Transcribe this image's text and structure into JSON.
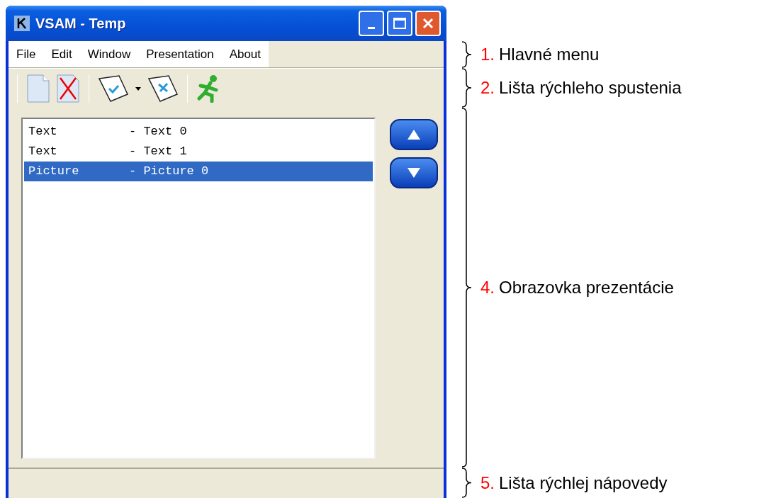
{
  "window": {
    "title": "VSAM - Temp"
  },
  "menu": [
    "File",
    "Edit",
    "Window",
    "Presentation",
    "About"
  ],
  "list": [
    {
      "type": "Text",
      "name": "- Text 0",
      "selected": false
    },
    {
      "type": "Text",
      "name": "- Text 1",
      "selected": false
    },
    {
      "type": "Picture",
      "name": "- Picture 0",
      "selected": true
    }
  ],
  "annotations": [
    {
      "number": "1.",
      "label": "Hlavné menu"
    },
    {
      "number": "2.",
      "label": "Lišta rýchleho spustenia"
    },
    {
      "number": "4.",
      "label": "Obrazovka prezentácie"
    },
    {
      "number": "5.",
      "label": "Lišta rýchlej nápovedy"
    }
  ]
}
